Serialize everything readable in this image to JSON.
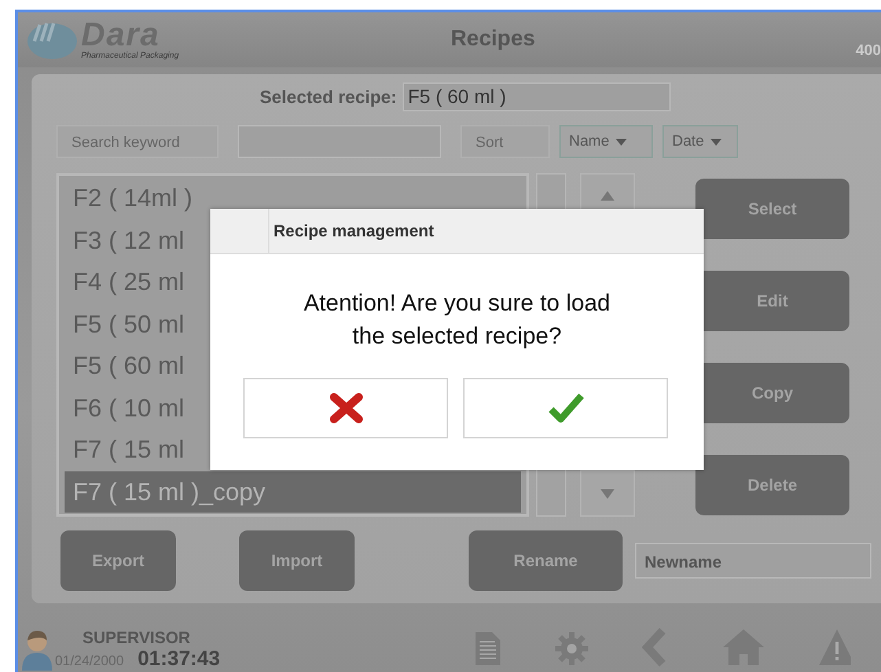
{
  "header": {
    "logo": "Dara",
    "logo_subtitle": "Pharmaceutical Packaging",
    "title": "Recipes",
    "corner_text": "400"
  },
  "selected_recipe": {
    "label": "Selected recipe:",
    "value": "F5 ( 60 ml )"
  },
  "search": {
    "label": "Search keyword"
  },
  "sort": {
    "label": "Sort",
    "options": [
      {
        "label": "Name"
      },
      {
        "label": "Date"
      }
    ]
  },
  "recipes": [
    {
      "name": "F2 ( 14ml )",
      "selected": false
    },
    {
      "name": "F3 ( 12 ml",
      "selected": false
    },
    {
      "name": "F4 ( 25 ml",
      "selected": false
    },
    {
      "name": "F5 ( 50 ml",
      "selected": false
    },
    {
      "name": "F5 ( 60 ml",
      "selected": false
    },
    {
      "name": "F6 ( 10 ml",
      "selected": false
    },
    {
      "name": "F7 ( 15 ml",
      "selected": false
    },
    {
      "name": "F7 ( 15 ml )_copy",
      "selected": true
    }
  ],
  "side_buttons": [
    "Select",
    "Edit",
    "Copy",
    "Delete"
  ],
  "bottom_buttons": [
    "Export",
    "Import"
  ],
  "rename": {
    "button": "Rename",
    "value": "Newname"
  },
  "status": {
    "user": "SUPERVISOR",
    "date": "01/24/2000",
    "time": "01:37:43"
  },
  "dialog": {
    "title": "Recipe management",
    "message": "Atention! Are you sure to load the selected recipe?",
    "buttons": [
      {
        "kind": "cancel"
      },
      {
        "kind": "confirm"
      }
    ]
  }
}
